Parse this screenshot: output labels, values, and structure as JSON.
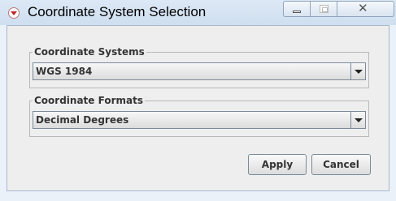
{
  "window": {
    "title": "Coordinate System Selection",
    "icon": "app-icon",
    "controls": {
      "minimize": "minimize-icon",
      "maximize": "maximize-icon",
      "close": "close-icon"
    }
  },
  "coordinate_systems": {
    "legend": "Coordinate Systems",
    "selected": "WGS 1984"
  },
  "coordinate_formats": {
    "legend": "Coordinate Formats",
    "selected": "Decimal Degrees"
  },
  "buttons": {
    "apply": "Apply",
    "cancel": "Cancel"
  }
}
